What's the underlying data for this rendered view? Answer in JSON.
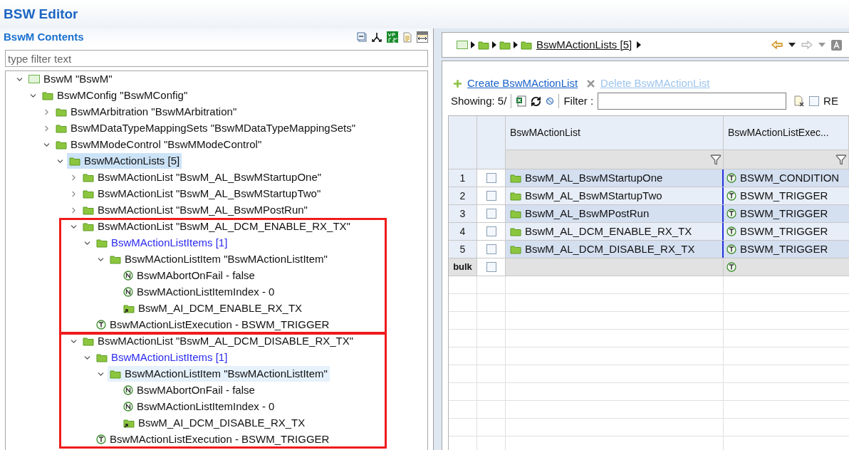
{
  "window": {
    "title": "BSW Editor"
  },
  "contents": {
    "title": "BswM Contents",
    "filter": {
      "placeholder": "type filter text"
    },
    "tree": [
      {
        "kind": "module",
        "label": "BswM \"BswM\"",
        "expanded": true,
        "selected": false,
        "children": [
          {
            "kind": "folder",
            "label": "BswMConfig \"BswMConfig\"",
            "expanded": true,
            "selected": false,
            "children": [
              {
                "kind": "folder",
                "label": "BswMArbitration \"BswMArbitration\"",
                "expanded": false,
                "selected": false
              },
              {
                "kind": "folder",
                "label": "BswMDataTypeMappingSets \"BswMDataTypeMappingSets\"",
                "expanded": false,
                "selected": false
              },
              {
                "kind": "folder",
                "label": "BswMModeControl \"BswMModeControl\"",
                "expanded": true,
                "selected": false,
                "children": [
                  {
                    "kind": "folder",
                    "label": "BswMActionLists [5]",
                    "expanded": true,
                    "selected": true,
                    "children": [
                      {
                        "kind": "folder",
                        "label": "BswMActionList \"BswM_AL_BswMStartupOne\"",
                        "expanded": false,
                        "selected": false
                      },
                      {
                        "kind": "folder",
                        "label": "BswMActionList \"BswM_AL_BswMStartupTwo\"",
                        "expanded": false,
                        "selected": false
                      },
                      {
                        "kind": "folder",
                        "label": "BswMActionList \"BswM_AL_BswMPostRun\"",
                        "expanded": false,
                        "selected": false
                      },
                      {
                        "kind": "folder",
                        "label": "BswMActionList \"BswM_AL_DCM_ENABLE_RX_TX\"",
                        "expanded": true,
                        "selected": false,
                        "highlighted": true,
                        "children": [
                          {
                            "kind": "list",
                            "label": "BswMActionListItems [1]",
                            "expanded": true,
                            "selected": false,
                            "children": [
                              {
                                "kind": "folder",
                                "label": "BswMActionListItem \"BswMActionListItem\"",
                                "expanded": true,
                                "selected": false,
                                "children": [
                                  {
                                    "kind": "number",
                                    "label": "BswMAbortOnFail - false",
                                    "selected": false
                                  },
                                  {
                                    "kind": "number",
                                    "label": "BswMActionListItemIndex - 0",
                                    "selected": false
                                  },
                                  {
                                    "kind": "reference",
                                    "label": "BswM_AI_DCM_ENABLE_RX_TX",
                                    "selected": false
                                  }
                                ]
                              }
                            ]
                          },
                          {
                            "kind": "text",
                            "label": "BswMActionListExecution - BSWM_TRIGGER",
                            "selected": false
                          }
                        ]
                      },
                      {
                        "kind": "folder",
                        "label": "BswMActionList \"BswM_AL_DCM_DISABLE_RX_TX\"",
                        "expanded": true,
                        "selected": false,
                        "highlighted": true,
                        "children": [
                          {
                            "kind": "list",
                            "label": "BswMActionListItems [1]",
                            "expanded": true,
                            "selected": false,
                            "children": [
                              {
                                "kind": "folder",
                                "label": "BswMActionListItem \"BswMActionListItem\"",
                                "expanded": true,
                                "selected": true,
                                "children": [
                                  {
                                    "kind": "number",
                                    "label": "BswMAbortOnFail - false",
                                    "selected": false
                                  },
                                  {
                                    "kind": "number",
                                    "label": "BswMActionListItemIndex - 0",
                                    "selected": false
                                  },
                                  {
                                    "kind": "reference",
                                    "label": "BswM_AI_DCM_DISABLE_RX_TX",
                                    "selected": false
                                  }
                                ]
                              }
                            ]
                          },
                          {
                            "kind": "text",
                            "label": "BswMActionListExecution - BSWM_TRIGGER",
                            "selected": false
                          }
                        ]
                      }
                    ]
                  }
                ]
              }
            ]
          }
        ]
      }
    ]
  },
  "breadcrumb": {
    "current": "BswMActionLists [5]"
  },
  "actions": {
    "create": {
      "label": "Create BswMActionList",
      "disabled": false
    },
    "delete": {
      "label": "Delete BswMActionList",
      "disabled": true
    }
  },
  "toolbar": {
    "showing": "Showing: 5/",
    "filter_label": "Filter :",
    "regex": {
      "label": "RE",
      "checked": false
    }
  },
  "table": {
    "columns": [
      "BswMActionList",
      "BswMActionListExec..."
    ],
    "rows": [
      {
        "number": "1",
        "checked": false,
        "name": "BswM_AL_BswMStartupOne",
        "execution": "BSWM_CONDITION"
      },
      {
        "number": "2",
        "checked": false,
        "name": "BswM_AL_BswMStartupTwo",
        "execution": "BSWM_TRIGGER"
      },
      {
        "number": "3",
        "checked": false,
        "name": "BswM_AL_BswMPostRun",
        "execution": "BSWM_TRIGGER"
      },
      {
        "number": "4",
        "checked": false,
        "name": "BswM_AL_DCM_ENABLE_RX_TX",
        "execution": "BSWM_TRIGGER"
      },
      {
        "number": "5",
        "checked": false,
        "name": "BswM_AL_DCM_DISABLE_RX_TX",
        "execution": "BSWM_TRIGGER"
      }
    ],
    "bulk": {
      "label": "bulk",
      "checked": false
    }
  }
}
